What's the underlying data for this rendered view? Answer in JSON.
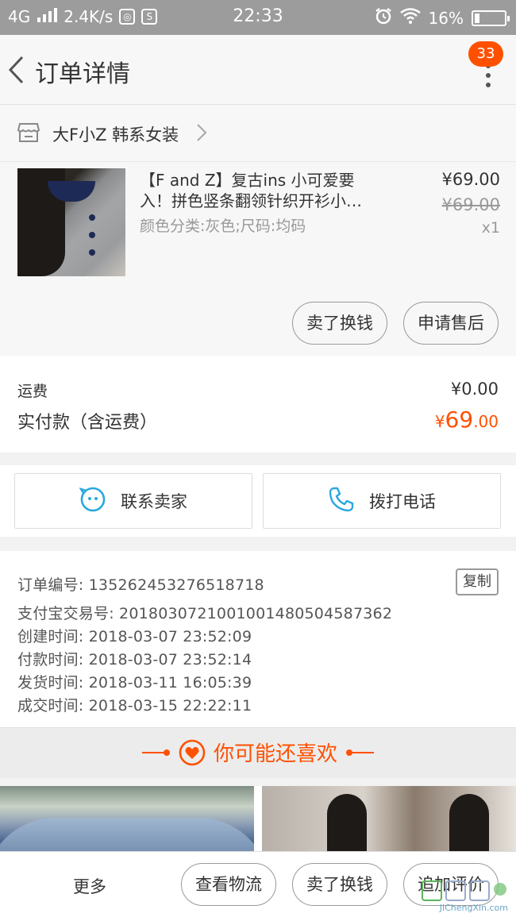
{
  "status_bar": {
    "network": "4G",
    "speed": "2.4K/s",
    "time": "22:33",
    "battery": "16%",
    "battery_level": 0.16,
    "icons": [
      "signal-icon",
      "notification-icon",
      "sim-icon",
      "alarm-icon",
      "wifi-icon",
      "battery-icon"
    ]
  },
  "header": {
    "title": "订单详情",
    "badge_count": "33"
  },
  "shop": {
    "name": "大F小Z 韩系女装"
  },
  "product": {
    "name": "【F and Z】复古ins 小可爱要入！拼色竖条翻领针织开衫小…",
    "sku": "颜色分类:灰色;尺码:均码",
    "price": "¥69.00",
    "original_price": "¥69.00",
    "quantity": "x1",
    "buttons": {
      "sell": "卖了换钱",
      "after_sale": "申请售后"
    }
  },
  "cost": {
    "freight_label": "运费",
    "freight_value": "¥0.00",
    "paid_label": "实付款（含运费）",
    "paid_currency": "¥",
    "paid_int": "69",
    "paid_dec": ".00"
  },
  "contact": {
    "seller": "联系卖家",
    "phone": "拨打电话"
  },
  "order_info": {
    "lines": [
      "订单编号: 1352624532765187​18",
      "支付宝交易号: 20180307210010014805045873​62",
      "创建时间: 2018-03-07 23:52:09",
      "付款时间: 2018-03-07 23:52:14",
      "发货时间: 2018-03-11 16:05:39",
      "成交时间: 2018-03-15 22:22:11"
    ],
    "copy_label": "复制"
  },
  "recommend": {
    "title": "你可能还喜欢"
  },
  "bottom_bar": {
    "more": "更多",
    "logistics": "查看物流",
    "sell": "卖了换钱",
    "review": "追加评价"
  },
  "watermark": {
    "text": "JiChengXin.com"
  },
  "colors": {
    "accent": "#ff5000",
    "icon_blue": "#2aa8e0"
  }
}
